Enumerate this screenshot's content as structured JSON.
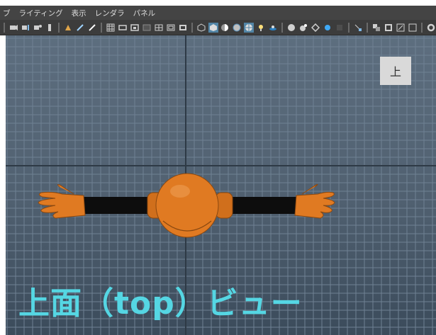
{
  "menubar": {
    "items": [
      "ブ",
      "ライティング",
      "表示",
      "レンダラ",
      "パネル"
    ]
  },
  "toolbar": {
    "icons": [
      "camera-icon",
      "camera-attr-icon",
      "bookmark-icon",
      "image-plane-icon",
      "2d-pan-zoom-icon",
      "grease-pencil-icon",
      "grid-icon",
      "film-gate-icon",
      "resolution-gate-icon",
      "gate-mask-icon",
      "field-chart-icon",
      "safe-action-icon",
      "safe-title-icon",
      "wireframe-icon",
      "smooth-shade-icon",
      "shade-selected-icon",
      "wireframe-on-shaded-icon",
      "textured-icon",
      "lights-icon",
      "shadows-icon",
      "ambient-occlusion-icon",
      "motion-blur-icon",
      "anti-alias-icon",
      "depth-of-field-icon",
      "isolate-select-icon",
      "xray-icon",
      "xray-joints-icon",
      "xray-components-icon",
      "settings-icon"
    ],
    "active_icon": "wireframe-on-shaded-icon"
  },
  "viewport": {
    "view_label": "上",
    "grid_color": "#6f8193",
    "axis_color": "#2e3a46",
    "character": {
      "body_color": "#e07a22",
      "limb_color": "#0d0d0d"
    }
  },
  "caption": {
    "text": "上面（top）ビュー",
    "color": "#55d6e3"
  }
}
